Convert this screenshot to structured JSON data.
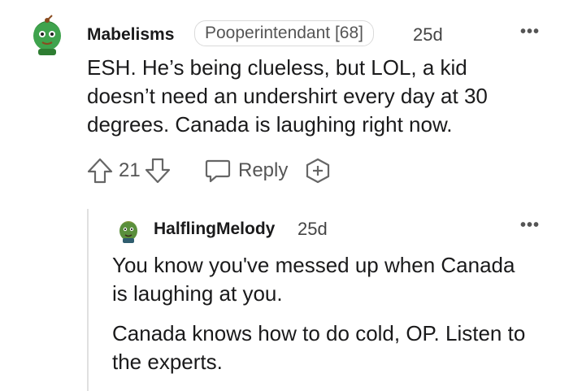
{
  "comments": [
    {
      "username": "Mabelisms",
      "flair": "Pooperintendant [68]",
      "age": "25d",
      "paragraphs": [
        "ESH. He’s being clueless, but LOL, a kid doesn’t need an undershirt every day at 30 degrees. Canada is laughing right now."
      ],
      "votes": "21",
      "reply_label": "Reply"
    },
    {
      "username": "HalflingMelody",
      "age": "25d",
      "paragraphs": [
        "You know you've messed up when Canada is laughing at you.",
        "Canada knows how to do cold, OP. Listen to the experts."
      ]
    }
  ],
  "more_label": "•••",
  "icons": {
    "upvote": "upvote-arrow-icon",
    "downvote": "downvote-arrow-icon",
    "reply": "speech-bubble-icon",
    "award": "award-plus-icon",
    "more": "more-dots-icon"
  },
  "colors": {
    "text": "#1a1a1b",
    "meta": "#555555",
    "thread_line": "#e0e0e0",
    "avatar_green": "#3fa34d"
  }
}
